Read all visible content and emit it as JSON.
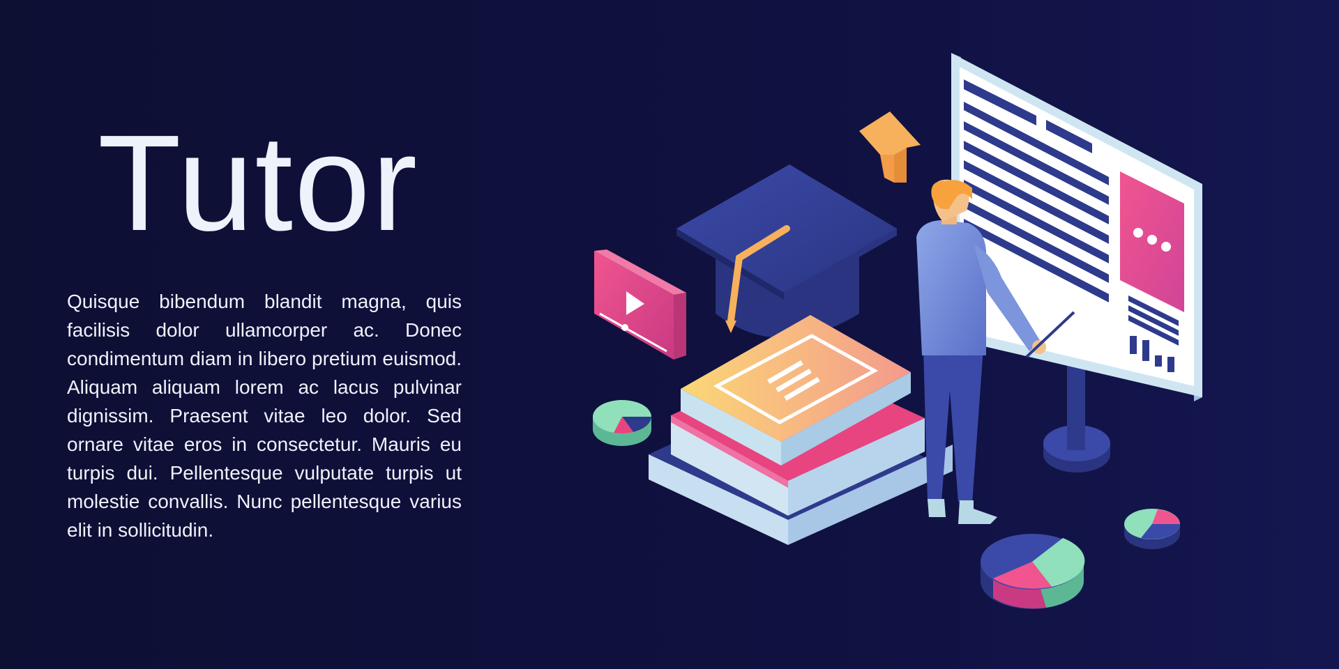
{
  "banner": {
    "title": "Tutor",
    "body": "Quisque bibendum blandit magna, quis facilisis dolor ullamcorper ac. Donec condimentum diam in libero pretium euismod. Aliquam aliquam lorem ac lacus pulvinar dignissim. Praesent vitae leo dolor. Sed ornare vitae eros in consectetur. Mauris eu turpis dui. Pellentesque vulputate turpis ut molestie convallis. Nunc pellentesque varius elit in sollicitudin."
  },
  "illustration": {
    "icons": [
      "graduation-cap-icon",
      "books-stack-icon",
      "video-play-icon",
      "up-arrow-icon",
      "presentation-board-icon",
      "pie-chart-icon"
    ],
    "colors": {
      "background": "#0d0f33",
      "text": "#eef2fb",
      "navy": "#2e3a8c",
      "pink": "#e8447f",
      "orange": "#f7b15c",
      "mint": "#7fd6a8"
    }
  }
}
